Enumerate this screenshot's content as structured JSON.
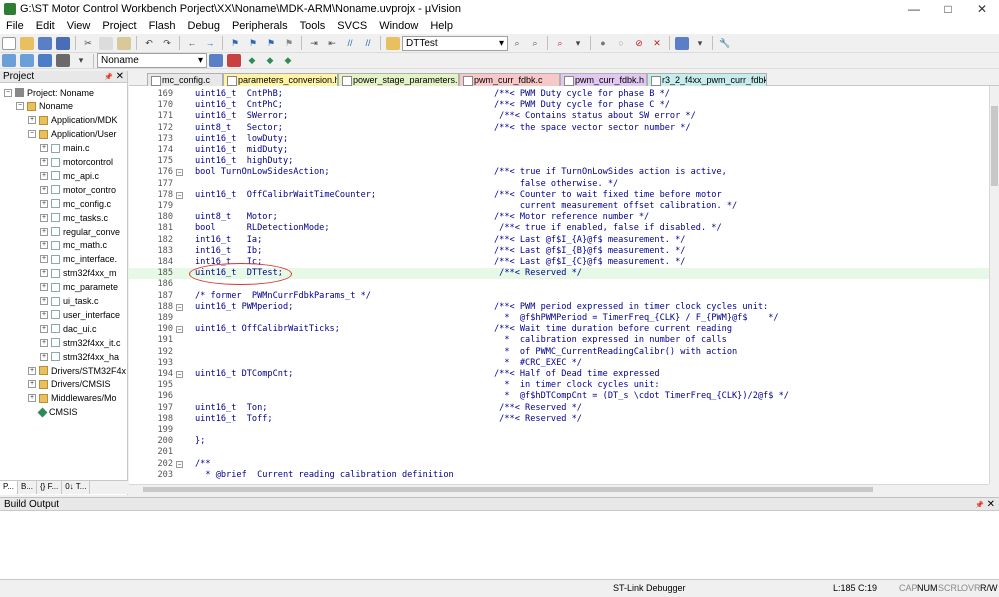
{
  "window": {
    "title": "G:\\ST Motor Control Workbench Porject\\XX\\Noname\\MDK-ARM\\Noname.uvprojx - µVision",
    "minimize": "—",
    "maximize": "□",
    "close": "✕"
  },
  "menu": [
    "File",
    "Edit",
    "View",
    "Project",
    "Flash",
    "Debug",
    "Peripherals",
    "Tools",
    "SVCS",
    "Window",
    "Help"
  ],
  "toolbar": {
    "find_combo_value": "DTTest",
    "target_combo_value": "Noname"
  },
  "project_panel": {
    "title": "Project",
    "pin": "📌",
    "close": "✕",
    "tree": [
      {
        "label": "Project: Noname",
        "level": 0,
        "kind": "proj",
        "expander": "−"
      },
      {
        "label": "Noname",
        "level": 1,
        "kind": "folder",
        "expander": "−"
      },
      {
        "label": "Application/MDK",
        "level": 2,
        "kind": "folder",
        "expander": "+"
      },
      {
        "label": "Application/User",
        "level": 2,
        "kind": "folder",
        "expander": "−"
      },
      {
        "label": "main.c",
        "level": 3,
        "kind": "file",
        "expander": "+"
      },
      {
        "label": "motorcontrol",
        "level": 3,
        "kind": "file",
        "expander": "+"
      },
      {
        "label": "mc_api.c",
        "level": 3,
        "kind": "file",
        "expander": "+"
      },
      {
        "label": "motor_contro",
        "level": 3,
        "kind": "file",
        "expander": "+"
      },
      {
        "label": "mc_config.c",
        "level": 3,
        "kind": "file",
        "expander": "+"
      },
      {
        "label": "mc_tasks.c",
        "level": 3,
        "kind": "file",
        "expander": "+"
      },
      {
        "label": "regular_conve",
        "level": 3,
        "kind": "file",
        "expander": "+"
      },
      {
        "label": "mc_math.c",
        "level": 3,
        "kind": "file",
        "expander": "+"
      },
      {
        "label": "mc_interface.",
        "level": 3,
        "kind": "file",
        "expander": "+"
      },
      {
        "label": "stm32f4xx_m",
        "level": 3,
        "kind": "file",
        "expander": "+"
      },
      {
        "label": "mc_paramete",
        "level": 3,
        "kind": "file",
        "expander": "+"
      },
      {
        "label": "ui_task.c",
        "level": 3,
        "kind": "file",
        "expander": "+"
      },
      {
        "label": "user_interface",
        "level": 3,
        "kind": "file",
        "expander": "+"
      },
      {
        "label": "dac_ui.c",
        "level": 3,
        "kind": "file",
        "expander": "+"
      },
      {
        "label": "stm32f4xx_it.c",
        "level": 3,
        "kind": "file",
        "expander": "+"
      },
      {
        "label": "stm32f4xx_ha",
        "level": 3,
        "kind": "file",
        "expander": "+"
      },
      {
        "label": "Drivers/STM32F4x",
        "level": 2,
        "kind": "folder",
        "expander": "+"
      },
      {
        "label": "Drivers/CMSIS",
        "level": 2,
        "kind": "folder",
        "expander": "+"
      },
      {
        "label": "Middlewares/Mo",
        "level": 2,
        "kind": "folder",
        "expander": "+"
      },
      {
        "label": "CMSIS",
        "level": 2,
        "kind": "gem",
        "expander": ""
      }
    ],
    "bottom_tabs": [
      "P...",
      "B...",
      "{} F...",
      "0↓ T..."
    ]
  },
  "editor_tabs": [
    {
      "label": "mc_config.c",
      "color": "#e8e8e8"
    },
    {
      "label": "parameters_conversion.h",
      "color": "#fff3a8"
    },
    {
      "label": "power_stage_parameters.h",
      "color": "#e4f2c8"
    },
    {
      "label": "pwm_curr_fdbk.c",
      "color": "#f6c8c8"
    },
    {
      "label": "pwm_curr_fdbk.h",
      "color": "#e0c8f0"
    },
    {
      "label": "r3_2_f4xx_pwm_curr_fdbk.c",
      "color": "#c8ecec"
    }
  ],
  "code_lines": [
    {
      "n": "169",
      "code": "uint16_t  CntPhB;",
      "comment": "/**< PWM Duty cycle for phase B */",
      "fold": ""
    },
    {
      "n": "170",
      "code": "uint16_t  CntPhC;",
      "comment": "/**< PWM Duty cycle for phase C */",
      "fold": ""
    },
    {
      "n": "171",
      "code": "uint16_t  SWerror;",
      "comment": " /**< Contains status about SW error */",
      "fold": ""
    },
    {
      "n": "172",
      "code": "uint8_t   Sector;",
      "comment": "/**< the space vector sector number */",
      "fold": ""
    },
    {
      "n": "173",
      "code": "uint16_t  lowDuty;",
      "comment": "",
      "fold": ""
    },
    {
      "n": "174",
      "code": "uint16_t  midDuty;",
      "comment": "",
      "fold": ""
    },
    {
      "n": "175",
      "code": "uint16_t  highDuty;",
      "comment": "",
      "fold": ""
    },
    {
      "n": "176",
      "code": "bool TurnOnLowSidesAction;",
      "comment": "/**< true if TurnOnLowSides action is active,",
      "fold": "−"
    },
    {
      "n": "177",
      "code": "",
      "comment": "     false otherwise. */",
      "fold": ""
    },
    {
      "n": "178",
      "code": "uint16_t  OffCalibrWaitTimeCounter;",
      "comment": "/**< Counter to wait fixed time before motor",
      "fold": "−"
    },
    {
      "n": "179",
      "code": "",
      "comment": "     current measurement offset calibration. */",
      "fold": ""
    },
    {
      "n": "180",
      "code": "uint8_t   Motor;",
      "comment": "/**< Motor reference number */",
      "fold": ""
    },
    {
      "n": "181",
      "code": "bool      RLDetectionMode;",
      "comment": " /**< true if enabled, false if disabled. */",
      "fold": ""
    },
    {
      "n": "182",
      "code": "int16_t   Ia;",
      "comment": "/**< Last @f$I_{A}@f$ measurement. */",
      "fold": ""
    },
    {
      "n": "183",
      "code": "int16_t   Ib;",
      "comment": "/**< Last @f$I_{B}@f$ measurement. */",
      "fold": ""
    },
    {
      "n": "184",
      "code": "int16_t   Ic;",
      "comment": "/**< Last @f$I_{C}@f$ measurement. */",
      "fold": ""
    },
    {
      "n": "185",
      "code": "uint16_t  DTTest;",
      "comment": " /**< Reserved */",
      "fold": ""
    },
    {
      "n": "186",
      "code": "",
      "comment": "",
      "fold": ""
    },
    {
      "n": "187",
      "code": "/* former  PWMnCurrFdbkParams_t */",
      "comment": "",
      "fold": ""
    },
    {
      "n": "188",
      "code": "uint16_t PWMperiod;",
      "comment": "/**< PWM period expressed in timer clock cycles unit:",
      "fold": "−"
    },
    {
      "n": "189",
      "code": "",
      "comment": "  *  @f$hPWMPeriod = TimerFreq_{CLK} / F_{PWM}@f$    */",
      "fold": ""
    },
    {
      "n": "190",
      "code": "uint16_t OffCalibrWaitTicks;",
      "comment": "/**< Wait time duration before current reading",
      "fold": "−"
    },
    {
      "n": "191",
      "code": "",
      "comment": "  *  calibration expressed in number of calls",
      "fold": ""
    },
    {
      "n": "192",
      "code": "",
      "comment": "  *  of PWMC_CurrentReadingCalibr() with action",
      "fold": ""
    },
    {
      "n": "193",
      "code": "",
      "comment": "  *  #CRC_EXEC */",
      "fold": ""
    },
    {
      "n": "194",
      "code": "uint16_t DTCompCnt;",
      "comment": "/**< Half of Dead time expressed",
      "fold": "−"
    },
    {
      "n": "195",
      "code": "",
      "comment": "  *  in timer clock cycles unit:",
      "fold": ""
    },
    {
      "n": "196",
      "code": "",
      "comment": "  *  @f$hDTCompCnt = (DT_s \\cdot TimerFreq_{CLK})/2@f$ */",
      "fold": ""
    },
    {
      "n": "197",
      "code": "uint16_t  Ton;",
      "comment": " /**< Reserved */",
      "fold": ""
    },
    {
      "n": "198",
      "code": "uint16_t  Toff;",
      "comment": " /**< Reserved */",
      "fold": ""
    },
    {
      "n": "199",
      "code": "",
      "comment": "",
      "fold": ""
    },
    {
      "n": "200",
      "code": "};",
      "comment": "",
      "fold": ""
    },
    {
      "n": "201",
      "code": "",
      "comment": "",
      "fold": ""
    },
    {
      "n": "202",
      "code": "/**",
      "comment": "",
      "fold": "−"
    },
    {
      "n": "203",
      "code": "  * @brief  Current reading calibration definition",
      "comment": "",
      "fold": ""
    }
  ],
  "highlighted_line": "185",
  "build_output": {
    "title": "Build Output",
    "pin": "📌",
    "close": "✕"
  },
  "status": {
    "debugger": "ST-Link Debugger",
    "position": "L:185 C:19",
    "cap": "CAP",
    "num": "NUM",
    "scrl": "SCRL",
    "ovr": "OVR",
    "rw": "R/W"
  },
  "colors": {
    "comment": "#000090",
    "line_highlight": "#e6f8e6",
    "annotation_circle": "#e03030"
  }
}
